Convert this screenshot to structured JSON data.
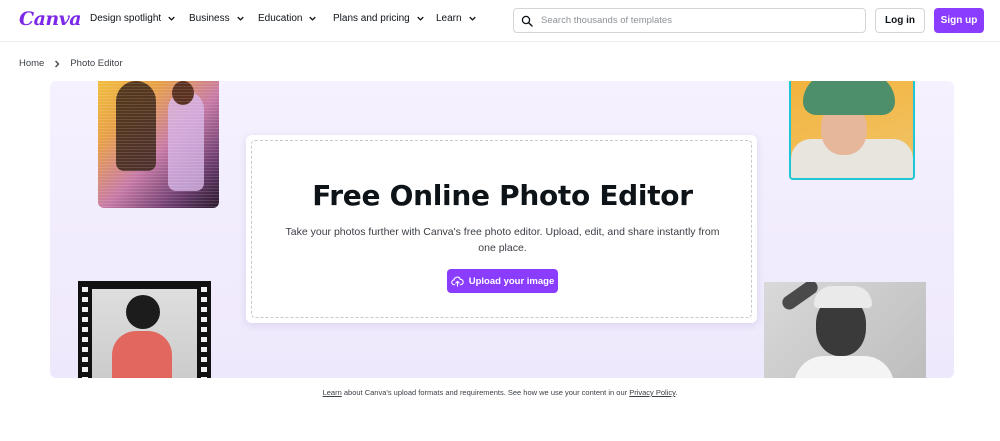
{
  "brand": {
    "logo_text": "Canva",
    "accent": "#8b3dff",
    "logo_color": "#7d2ae8"
  },
  "nav": {
    "items": [
      {
        "label": "Design spotlight"
      },
      {
        "label": "Business"
      },
      {
        "label": "Education"
      },
      {
        "label": "Plans and pricing"
      },
      {
        "label": "Learn"
      }
    ],
    "search": {
      "placeholder": "Search thousands of templates",
      "icon": "search-icon"
    },
    "login_label": "Log in",
    "signup_label": "Sign up"
  },
  "breadcrumb": {
    "items": [
      "Home",
      "Photo Editor"
    ],
    "separator_icon": "chevron-right-icon"
  },
  "hero": {
    "title": "Free Online Photo Editor",
    "subtitle": "Take your photos further with Canva's free photo editor. Upload, edit, and share instantly from one place.",
    "upload_label": "Upload your image",
    "upload_icon": "cloud-upload-icon",
    "background": "#f3eefd",
    "photo_border_color": "#1ec6d6"
  },
  "footnote": {
    "learn_link": "Learn",
    "text": " about Canva's upload formats and requirements. See how we use your content in our ",
    "privacy_link": "Privacy Policy",
    "end": "."
  }
}
